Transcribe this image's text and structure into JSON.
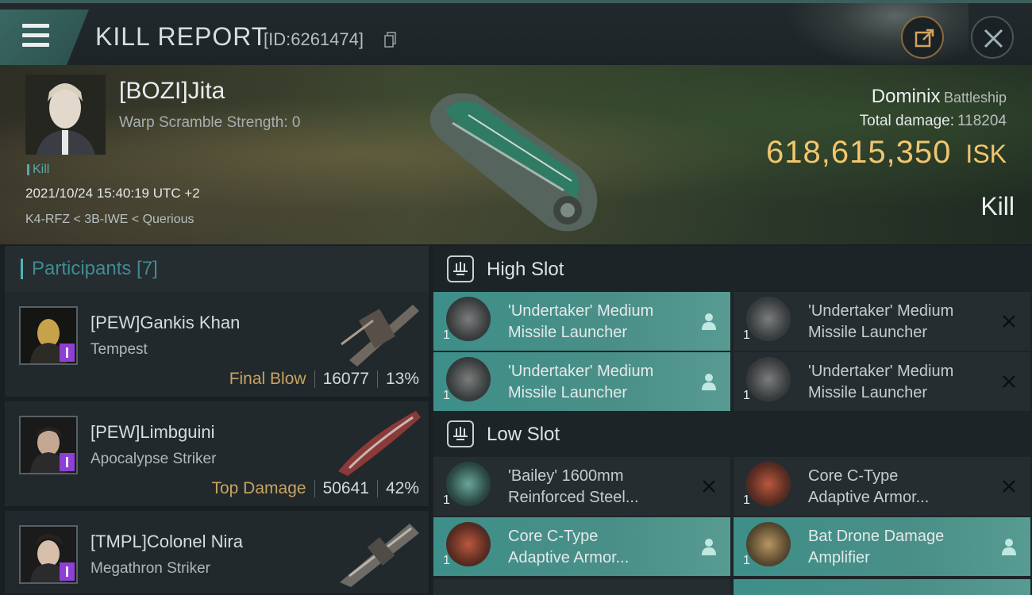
{
  "header": {
    "title": "KILL REPORT",
    "id_label": "[ID:6261474]",
    "icons": {
      "menu": "hamburger-menu-icon",
      "copy": "copy-icon",
      "share": "share-external-icon",
      "close": "close-icon"
    },
    "accent": "#3a6864"
  },
  "victim": {
    "name": "[BOZI]Jita",
    "warp_scramble": "Warp Scramble Strength: 0",
    "tag": "Kill",
    "datetime": "2021/10/24 15:40:19 UTC +2",
    "location": "K4-RFZ < 3B-IWE < Querious"
  },
  "ship": {
    "name": "Dominix",
    "class": "Battleship",
    "total_damage_label": "Total damage:",
    "total_damage": "118204",
    "isk_value": "618,615,350",
    "isk_unit": "ISK",
    "result": "Kill"
  },
  "participants": {
    "header": "Participants [7]",
    "rows": [
      {
        "name": "[PEW]Gankis Khan",
        "ship": "Tempest",
        "label": "Final Blow",
        "damage": "16077",
        "percent": "13%"
      },
      {
        "name": "[PEW]Limbguini",
        "ship": "Apocalypse Striker",
        "label": "Top Damage",
        "damage": "50641",
        "percent": "42%"
      },
      {
        "name": "[TMPL]Colonel Nira",
        "ship": "Megathron Striker",
        "label": "",
        "damage": "",
        "percent": ""
      }
    ]
  },
  "slots": {
    "high": {
      "title": "High Slot",
      "modules": [
        {
          "line1": "'Undertaker' Medium",
          "line2": "Missile Launcher",
          "qty": "1",
          "state": "dropped"
        },
        {
          "line1": "'Undertaker' Medium",
          "line2": "Missile Launcher",
          "qty": "1",
          "state": "destroyed"
        },
        {
          "line1": "'Undertaker' Medium",
          "line2": "Missile Launcher",
          "qty": "1",
          "state": "dropped"
        },
        {
          "line1": "'Undertaker' Medium",
          "line2": "Missile Launcher",
          "qty": "1",
          "state": "destroyed"
        }
      ]
    },
    "low": {
      "title": "Low Slot",
      "modules": [
        {
          "line1": "'Bailey' 1600mm",
          "line2": "Reinforced Steel...",
          "qty": "1",
          "state": "destroyed"
        },
        {
          "line1": "Core C-Type",
          "line2": "Adaptive Armor...",
          "qty": "1",
          "state": "destroyed"
        },
        {
          "line1": "Core C-Type",
          "line2": "Adaptive Armor...",
          "qty": "1",
          "state": "dropped"
        },
        {
          "line1": "Bat Drone Damage",
          "line2": "Amplifier",
          "qty": "1",
          "state": "dropped"
        }
      ]
    }
  }
}
